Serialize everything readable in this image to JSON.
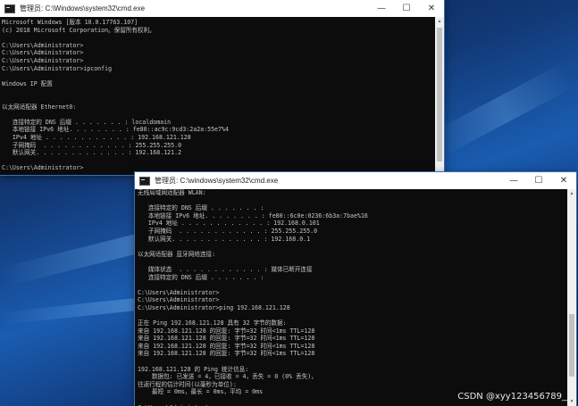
{
  "window1": {
    "title": "管理员: C:\\Windows\\system32\\cmd.exe",
    "lines": [
      "Microsoft Windows [版本 10.0.17763.107]",
      "(c) 2018 Microsoft Corporation。保留所有权利。",
      "",
      "C:\\Users\\Administrator>",
      "C:\\Users\\Administrator>",
      "C:\\Users\\Administrator>",
      "C:\\Users\\Administrator>ipconfig",
      "",
      "Windows IP 配置",
      "",
      "",
      "以太网适配器 Ethernet0:",
      "",
      "   连接特定的 DNS 后缀 . . . . . . . : localdomain",
      "   本地链接 IPv6 地址. . . . . . . . : fe80::ac9c:9cd3:2a2a:55e7%4",
      "   IPv4 地址 . . . . . . . . . . . . : 192.168.121.128",
      "   子网掩码  . . . . . . . . . . . . : 255.255.255.0",
      "   默认网关. . . . . . . . . . . . . : 192.168.121.2",
      "",
      "C:\\Users\\Administrator>"
    ]
  },
  "window2": {
    "title": "管理员: C:\\windows\\system32\\cmd.exe",
    "lines": [
      "无线局域网适配器 WLAN:",
      "",
      "   连接特定的 DNS 后缀 . . . . . . . :",
      "   本地链接 IPv6 地址. . . . . . . . : fe80::6c0e:0236:6b3a:7bae%16",
      "   IPv4 地址 . . . . . . . . . . . . : 192.168.0.101",
      "   子网掩码  . . . . . . . . . . . . : 255.255.255.0",
      "   默认网关. . . . . . . . . . . . . : 192.168.0.1",
      "",
      "以太网适配器 蓝牙网络连接:",
      "",
      "   媒体状态  . . . . . . . . . . . . : 媒体已断开连接",
      "   连接特定的 DNS 后缀 . . . . . . . :",
      "",
      "C:\\Users\\Administrator>",
      "C:\\Users\\Administrator>",
      "C:\\Users\\Administrator>ping 192.168.121.128",
      "",
      "正在 Ping 192.168.121.128 具有 32 字节的数据:",
      "来自 192.168.121.128 的回复: 字节=32 时间<1ms TTL=128",
      "来自 192.168.121.128 的回复: 字节=32 时间<1ms TTL=128",
      "来自 192.168.121.128 的回复: 字节=32 时间<1ms TTL=128",
      "来自 192.168.121.128 的回复: 字节=32 时间<1ms TTL=128",
      "",
      "192.168.121.128 的 Ping 统计信息:",
      "    数据包: 已发送 = 4，已接收 = 4，丢失 = 0 (0% 丢失)，",
      "往返行程的估计时间(以毫秒为单位):",
      "    最短 = 0ms，最长 = 0ms，平均 = 0ms",
      "",
      "C:\\Users\\Administrator>_"
    ]
  },
  "controls": {
    "minimize": "—",
    "maximize": "☐",
    "close": "✕"
  },
  "watermark": "CSDN @xyy123456789__"
}
